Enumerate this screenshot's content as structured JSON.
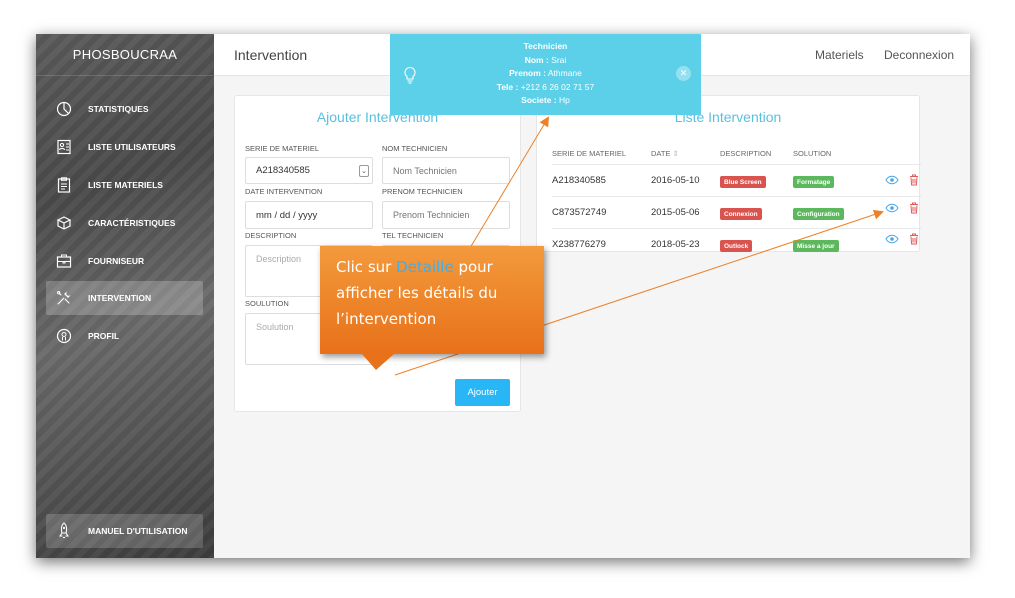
{
  "brand": "PHOSBOUCRAA",
  "sidebar": {
    "items": [
      {
        "label": "STATISTIQUES",
        "icon": "pie-chart-icon"
      },
      {
        "label": "LISTE UTILISATEURS",
        "icon": "users-list-icon"
      },
      {
        "label": "LISTE MATERIELS",
        "icon": "clipboard-icon"
      },
      {
        "label": "CARACTÉRISTIQUES",
        "icon": "box-icon"
      },
      {
        "label": "FOURNISEUR",
        "icon": "briefcase-icon"
      },
      {
        "label": "INTERVENTION",
        "icon": "tools-icon"
      },
      {
        "label": "PROFIL",
        "icon": "profile-icon"
      }
    ],
    "active": "INTERVENTION",
    "manual_label": "MANUEL D'UTILISATION"
  },
  "header": {
    "title": "Intervention",
    "links": [
      "Materiels",
      "Deconnexion"
    ]
  },
  "form": {
    "title": "Ajouter Intervention",
    "serie_label": "SERIE DE MATERIEL",
    "serie_value": "A218340585",
    "nom_label": "NOM TECHNICIEN",
    "nom_placeholder": "Nom Technicien",
    "date_label": "DATE INTERVENTION",
    "date_placeholder": "mm / dd / yyyy",
    "prenom_label": "PRENOM TECHNICIEN",
    "prenom_placeholder": "Prenom Technicien",
    "description_label": "DESCRIPTION",
    "description_placeholder": "Description",
    "tel_label": "TEL TECHNICIEN",
    "solution_label": "SOULUTION",
    "solution_placeholder": "Soulution",
    "submit_label": "Ajouter"
  },
  "table": {
    "title": "Liste Intervention",
    "headers": [
      "SERIE DE MATERIEL",
      "DATE",
      "DESCRIPTION",
      "SOLUTION"
    ],
    "rows": [
      {
        "serie": "A218340585",
        "date": "2016-05-10",
        "description": "Blue Screen",
        "solution": "Formatage"
      },
      {
        "serie": "C873572749",
        "date": "2015-05-06",
        "description": "Connexion",
        "solution": "Configuration"
      },
      {
        "serie": "X238776279",
        "date": "2018-05-23",
        "description": "Outlock",
        "solution": "Misse a jour"
      }
    ]
  },
  "tooltip": {
    "title": "Technicien",
    "nom_key": "Nom :",
    "nom": "Srai",
    "prenom_key": "Prenom :",
    "prenom": "Athmane",
    "tele_key": "Tele :",
    "tele": "+212 6 26 02 71 57",
    "societe_key": "Societe :",
    "societe": "Hp"
  },
  "callout": {
    "before": "Clic sur ",
    "highlight": "Detaille",
    "after": " pour afficher les détails du l’intervention"
  },
  "colors": {
    "accent": "#5bc0de",
    "button": "#29b6f6",
    "danger": "#d9534f",
    "success": "#5cb85c",
    "callout": "#ee8128",
    "tooltip": "#5bd0e8"
  }
}
